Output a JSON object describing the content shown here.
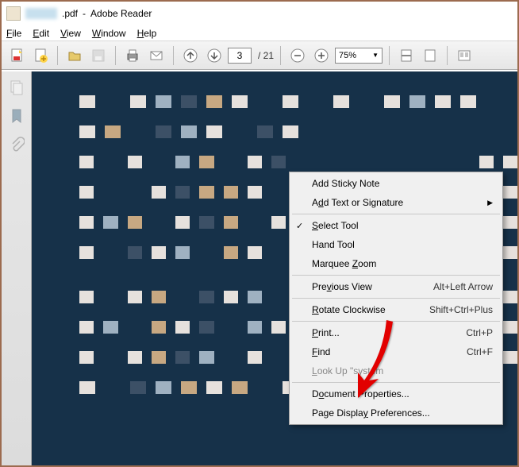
{
  "title": {
    "filename": ".pdf",
    "app": "Adobe Reader"
  },
  "menu": {
    "file": "File",
    "edit": "Edit",
    "view": "View",
    "window": "Window",
    "help": "Help"
  },
  "toolbar": {
    "page_current": "3",
    "page_total": "/ 21",
    "zoom": "75%"
  },
  "context_menu": {
    "add_sticky": "Add Sticky Note",
    "add_text_sig": "Add Text or Signature",
    "select_tool": "Select Tool",
    "hand_tool": "Hand Tool",
    "marquee_zoom": "Marquee Zoom",
    "prev_view": "Previous View",
    "prev_view_kb": "Alt+Left Arrow",
    "rotate_cw": "Rotate Clockwise",
    "rotate_cw_kb": "Shift+Ctrl+Plus",
    "print": "Print...",
    "print_kb": "Ctrl+P",
    "find": "Find",
    "find_kb": "Ctrl+F",
    "lookup": "Look Up \"system",
    "doc_props": "Document Properties...",
    "page_display": "Page Display Preferences..."
  }
}
